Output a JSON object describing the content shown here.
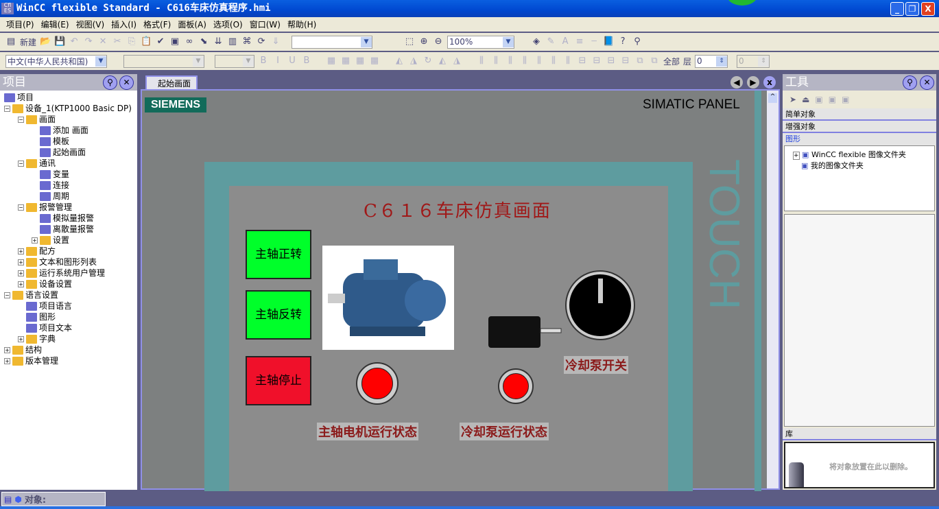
{
  "window": {
    "title": "WinCC flexible Standard - C616车床仿真程序.hmi",
    "icon_text": "Cfl ES",
    "min": "_",
    "max": "❐",
    "close": "X"
  },
  "menu": [
    "项目(P)",
    "编辑(E)",
    "视图(V)",
    "插入(I)",
    "格式(F)",
    "面板(A)",
    "选项(O)",
    "窗口(W)",
    "帮助(H)"
  ],
  "toolbar": {
    "new_label": "新建",
    "zoom_value": "100%",
    "language": "中文(中华人民共和国)",
    "all_label": "全部",
    "layer_label": "层",
    "layer_value": "0",
    "layer_value2": "0"
  },
  "project_panel": {
    "title": "项目",
    "tree": [
      {
        "label": "项目",
        "level": 0,
        "toggle": ""
      },
      {
        "label": "设备_1(KTP1000 Basic DP)",
        "level": 0,
        "toggle": "−"
      },
      {
        "label": "画面",
        "level": 1,
        "toggle": "−"
      },
      {
        "label": "添加 画面",
        "level": 2,
        "toggle": ""
      },
      {
        "label": "模板",
        "level": 2,
        "toggle": ""
      },
      {
        "label": "起始画面",
        "level": 2,
        "toggle": ""
      },
      {
        "label": "通讯",
        "level": 1,
        "toggle": "−"
      },
      {
        "label": "变量",
        "level": 2,
        "toggle": ""
      },
      {
        "label": "连接",
        "level": 2,
        "toggle": ""
      },
      {
        "label": "周期",
        "level": 2,
        "toggle": ""
      },
      {
        "label": "报警管理",
        "level": 1,
        "toggle": "−"
      },
      {
        "label": "模拟量报警",
        "level": 2,
        "toggle": ""
      },
      {
        "label": "离散量报警",
        "level": 2,
        "toggle": ""
      },
      {
        "label": "设置",
        "level": 2,
        "toggle": "+"
      },
      {
        "label": "配方",
        "level": 1,
        "toggle": "+"
      },
      {
        "label": "文本和图形列表",
        "level": 1,
        "toggle": "+"
      },
      {
        "label": "运行系统用户管理",
        "level": 1,
        "toggle": "+"
      },
      {
        "label": "设备设置",
        "level": 1,
        "toggle": "+"
      },
      {
        "label": "语言设置",
        "level": 0,
        "toggle": "−"
      },
      {
        "label": "项目语言",
        "level": 1,
        "toggle": ""
      },
      {
        "label": "图形",
        "level": 1,
        "toggle": ""
      },
      {
        "label": "项目文本",
        "level": 1,
        "toggle": ""
      },
      {
        "label": "字典",
        "level": 1,
        "toggle": "+"
      },
      {
        "label": "结构",
        "level": 0,
        "toggle": "+"
      },
      {
        "label": "版本管理",
        "level": 0,
        "toggle": "+"
      }
    ]
  },
  "editor": {
    "tab": "起始画面",
    "brand": "SIEMENS",
    "panel_name": "SIMATIC PANEL",
    "touch": "TOUCH"
  },
  "hmi": {
    "title": "C６１６车床仿真画面",
    "btn_forward": "主轴正转",
    "btn_reverse": "主轴反转",
    "btn_stop": "主轴停止",
    "label_pump_switch": "冷却泵开关",
    "label_spindle_status": "主轴电机运行状态",
    "label_pump_status": "冷却泵运行状态",
    "colors": {
      "green": "#00ff2a",
      "red": "#f0102a",
      "lamp": "#ff0000"
    }
  },
  "tools_panel": {
    "title": "工具",
    "sections": [
      "简单对象",
      "增强对象",
      "图形"
    ],
    "folders": [
      "WinCC flexible 图像文件夹",
      "我的图像文件夹"
    ],
    "library": "库",
    "trash_hint": "将对象放置在此以删除。"
  },
  "statusbar": {
    "objects": "对象:"
  }
}
